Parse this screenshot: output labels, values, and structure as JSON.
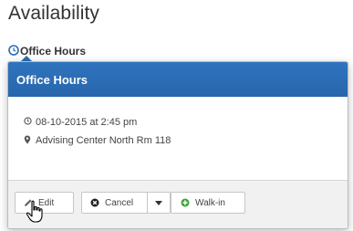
{
  "page": {
    "title": "Availability",
    "section_label": "Office Hours"
  },
  "popover": {
    "title": "Office Hours",
    "datetime": "08-10-2015 at 2:45 pm",
    "location": "Advising Center North Rm 118"
  },
  "actions": {
    "edit_label": "Edit",
    "cancel_label": "Cancel",
    "walkin_label": "Walk-in"
  },
  "colors": {
    "header_blue": "#2a6cb5",
    "cancel_icon": "#222222",
    "walkin_icon": "#3aa53a"
  },
  "icons": {
    "section": "clock-icon",
    "datetime": "clock-icon",
    "location": "map-marker-icon",
    "edit": "pencil-icon",
    "cancel": "cancel-circle-icon",
    "cancel_menu": "caret-down-icon",
    "walkin": "plus-circle-icon",
    "cursor": "hand-pointer-icon"
  }
}
